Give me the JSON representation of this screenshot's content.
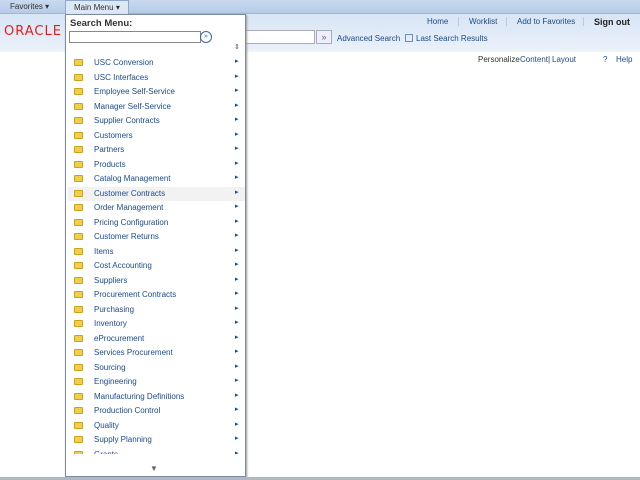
{
  "topbar": {
    "favorites": "Favorites",
    "main_menu": "Main Menu"
  },
  "header": {
    "logo": "ORACLE",
    "nav": [
      "Home",
      "Worklist",
      "Add to Favorites",
      "Sign out"
    ],
    "advanced_search": "Advanced Search",
    "last_search_results": "Last Search Results"
  },
  "page": {
    "personalize": "Personalize",
    "content": "Content",
    "pipe": "|",
    "layout": "Layout",
    "help": "Help"
  },
  "menu": {
    "search_label": "Search Menu:",
    "search_value": "",
    "highlighted": "Customer Contracts",
    "items": [
      "USC Conversion",
      "USC Interfaces",
      "Employee Self-Service",
      "Manager Self-Service",
      "Supplier Contracts",
      "Customers",
      "Partners",
      "Products",
      "Catalog Management",
      "Customer Contracts",
      "Order Management",
      "Pricing Configuration",
      "Customer Returns",
      "Items",
      "Cost Accounting",
      "Suppliers",
      "Procurement Contracts",
      "Purchasing",
      "Inventory",
      "eProcurement",
      "Services Procurement",
      "Sourcing",
      "Engineering",
      "Manufacturing Definitions",
      "Production Control",
      "Quality",
      "Supply Planning",
      "Grants"
    ]
  }
}
